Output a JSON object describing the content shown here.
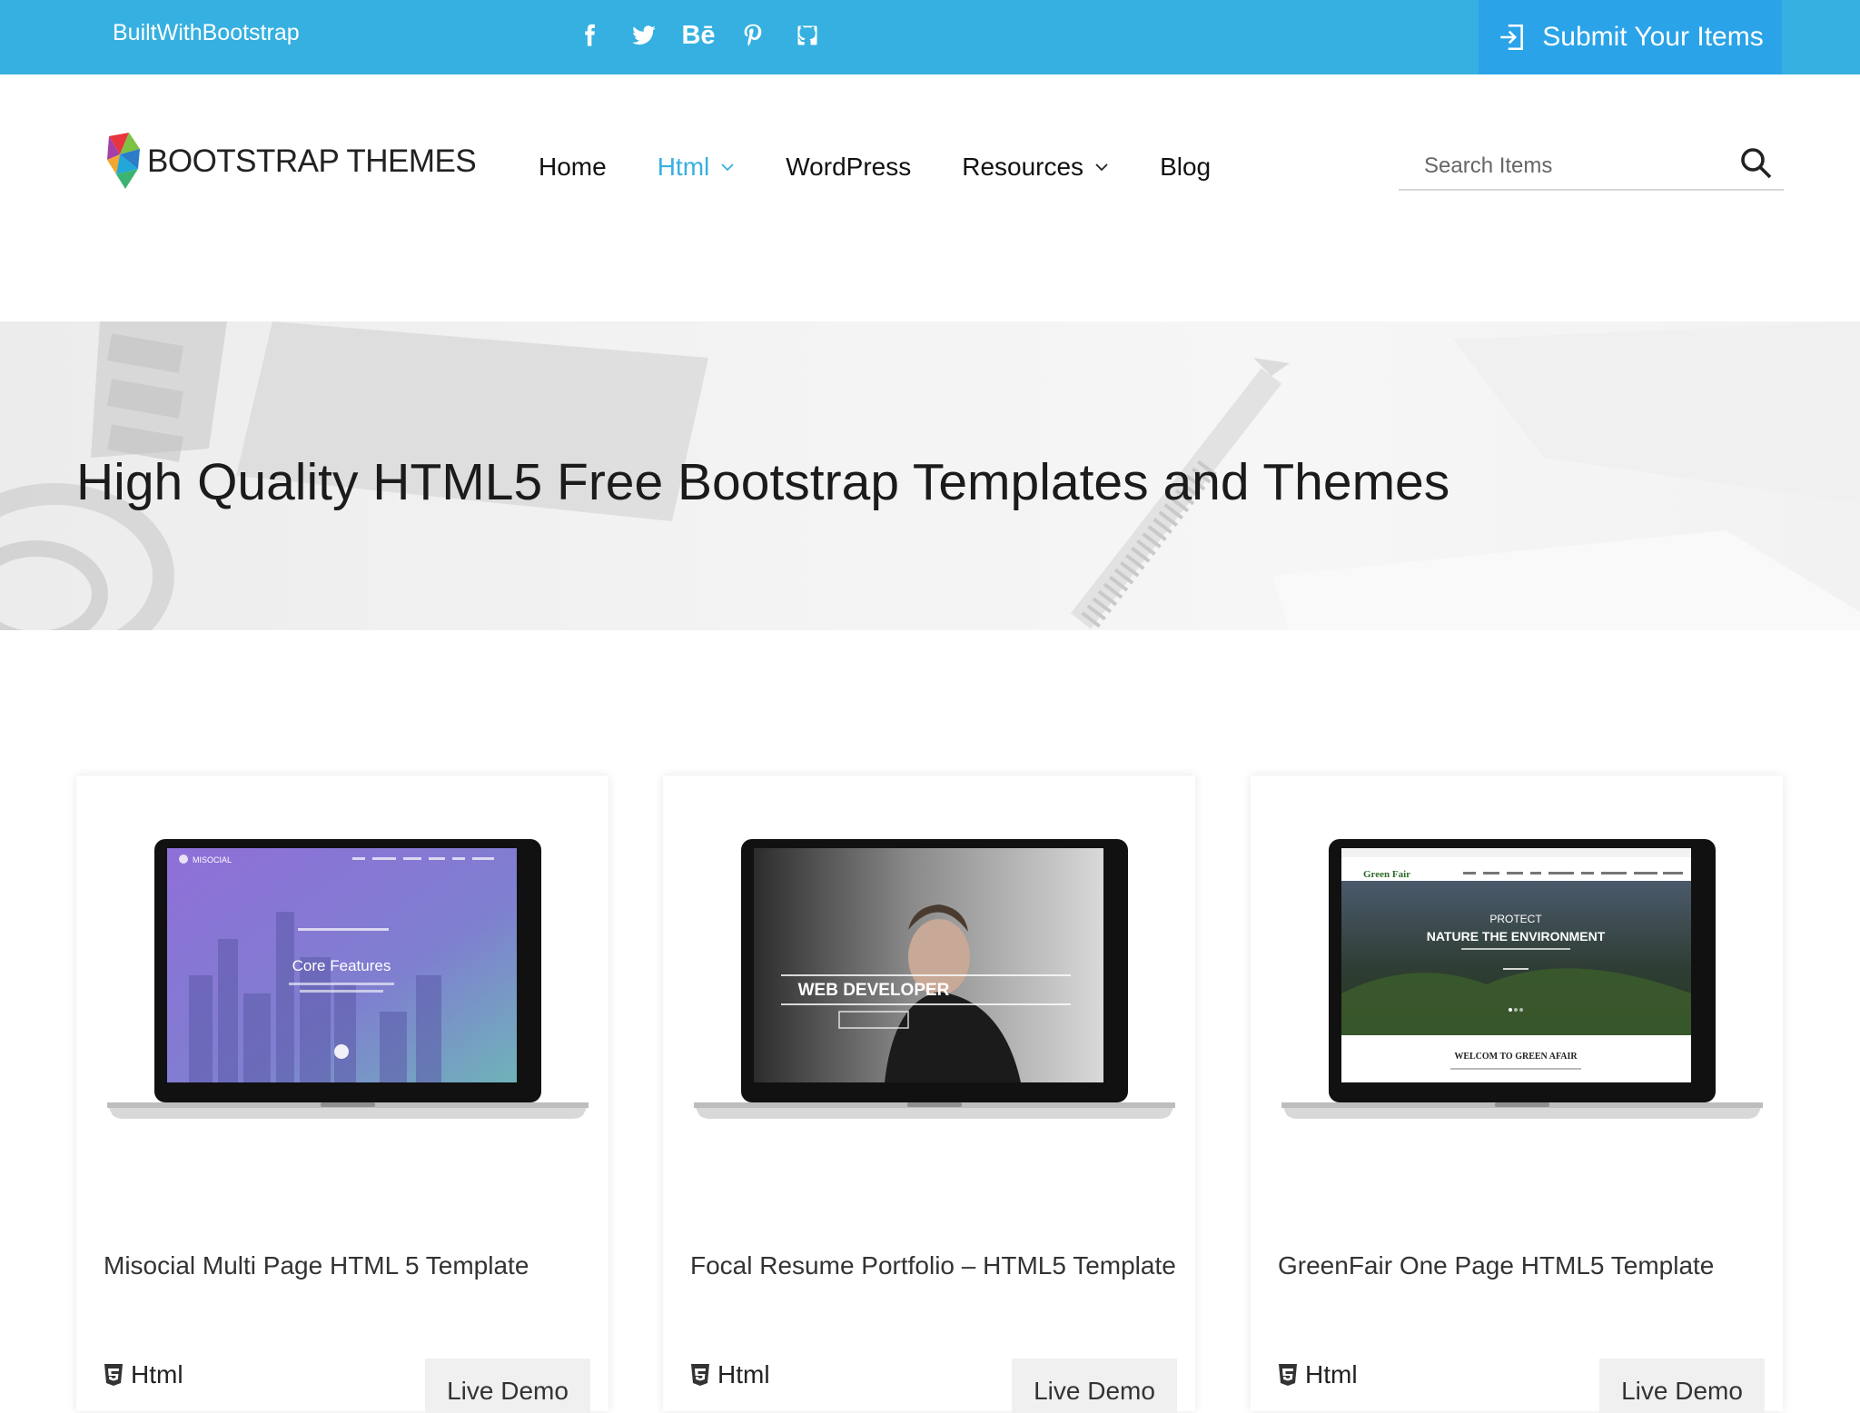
{
  "topbar": {
    "brand_link": "BuiltWithBootstrap",
    "social": [
      "facebook-icon",
      "twitter-icon",
      "behance-icon",
      "pinterest-icon",
      "github-icon"
    ],
    "behance_label": "Bē",
    "submit_label": "Submit Your Items",
    "bg_color": "#36b0e0",
    "submit_color": "#2aa3e9"
  },
  "header": {
    "logo_text": "BOOTSTRAP THEMES",
    "nav": {
      "home": "Home",
      "html": "Html",
      "wordpress": "WordPress",
      "resources": "Resources",
      "blog": "Blog"
    },
    "active_nav": "Html",
    "accent_color": "#36b0e0",
    "search": {
      "placeholder": "Search Items",
      "value": ""
    }
  },
  "hero": {
    "heading": "High Quality HTML5 Free Bootstrap Templates and Themes"
  },
  "cards": [
    {
      "title": "Misocial Multi Page HTML 5 Template",
      "category": "Html",
      "demo_label": "Live Demo",
      "screen_brand": "MISOCIAL",
      "screen_heading": "Core Features"
    },
    {
      "title": "Focal Resume Portfolio – HTML5 Template",
      "category": "Html",
      "demo_label": "Live Demo",
      "screen_heading": "WEB DEVELOPER"
    },
    {
      "title": "GreenFair One Page HTML5 Template",
      "category": "Html",
      "demo_label": "Live Demo",
      "screen_brand": "Green Fair",
      "screen_kicker": "PROTECT",
      "screen_heading": "NATURE THE ENVIRONMENT",
      "screen_footer": "WELCOM TO GREEN AFAIR"
    }
  ]
}
